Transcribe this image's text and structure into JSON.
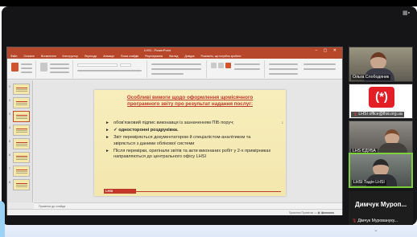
{
  "powerpoint": {
    "title": "LHSI - PowerPoint",
    "window_controls": "– ▢ ✕",
    "menu": [
      "Файл",
      "Основне",
      "Вставлення",
      "Конструктор",
      "Переходи",
      "Анімація",
      "Показ слайдів",
      "Рецензування",
      "Вигляд",
      "Довідка",
      "Розкажіть, що потрібно зробити"
    ],
    "notes_placeholder": "Примітки до слайда",
    "status_right": "Примітки  Примітки  ▭  ▦  ▣  –",
    "slide_thumbnail_numbers": [
      "1",
      "2",
      "3",
      "4",
      "5",
      "6",
      "7",
      "8",
      "9"
    ]
  },
  "slide": {
    "title": "Особливі вимоги щодо оформлення щомісячного програмного звіту про результат надання послуг:",
    "bullets": [
      "обов'язковий підпис виконавця із зазначенням ПІБ поруч;",
      "✓ односторонні роздруківка.",
      "Звіт перевіряється документатором й спеціалістом-аналітиком та звіряється з даними облікової системи",
      "Після перевірки, оригінали звітів та акти виконаних робіт у 2-х примірниках направляються до центрального офісу LHSI"
    ],
    "logo_text": "LHSI",
    "side_number": "1"
  },
  "participants": [
    {
      "name": "Ольга Слободяник",
      "muted": false
    },
    {
      "name": "LHSI office@lhsi.org.ua",
      "muted": true,
      "logo": "(*)"
    },
    {
      "name": "LHS  ЄДУБА",
      "muted": false
    },
    {
      "name": "LHSI Тадія LHSI",
      "muted": false
    },
    {
      "name": "Димчук  Муроп...",
      "caption": "Дімчук Муровануку...",
      "muted": true
    }
  ],
  "colors": {
    "ppt_accent": "#b7472a",
    "slide_title": "#c0392b",
    "lhsi_red": "#e41e26",
    "active_speaker_border": "#7ad13a"
  },
  "icons": {
    "fullscreen": "fullscreen-icon",
    "mute": "mic-off-icon",
    "chevron": "chevron-down-icon"
  }
}
